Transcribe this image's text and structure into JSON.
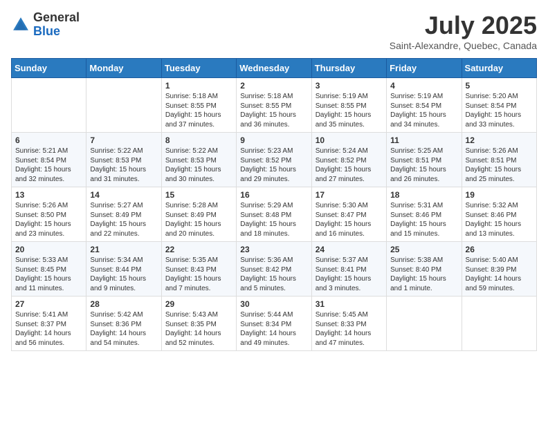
{
  "header": {
    "logo_general": "General",
    "logo_blue": "Blue",
    "month_year": "July 2025",
    "location": "Saint-Alexandre, Quebec, Canada"
  },
  "days_of_week": [
    "Sunday",
    "Monday",
    "Tuesday",
    "Wednesday",
    "Thursday",
    "Friday",
    "Saturday"
  ],
  "weeks": [
    [
      {
        "day": "",
        "sunrise": "",
        "sunset": "",
        "daylight": ""
      },
      {
        "day": "",
        "sunrise": "",
        "sunset": "",
        "daylight": ""
      },
      {
        "day": "1",
        "sunrise": "Sunrise: 5:18 AM",
        "sunset": "Sunset: 8:55 PM",
        "daylight": "Daylight: 15 hours and 37 minutes."
      },
      {
        "day": "2",
        "sunrise": "Sunrise: 5:18 AM",
        "sunset": "Sunset: 8:55 PM",
        "daylight": "Daylight: 15 hours and 36 minutes."
      },
      {
        "day": "3",
        "sunrise": "Sunrise: 5:19 AM",
        "sunset": "Sunset: 8:55 PM",
        "daylight": "Daylight: 15 hours and 35 minutes."
      },
      {
        "day": "4",
        "sunrise": "Sunrise: 5:19 AM",
        "sunset": "Sunset: 8:54 PM",
        "daylight": "Daylight: 15 hours and 34 minutes."
      },
      {
        "day": "5",
        "sunrise": "Sunrise: 5:20 AM",
        "sunset": "Sunset: 8:54 PM",
        "daylight": "Daylight: 15 hours and 33 minutes."
      }
    ],
    [
      {
        "day": "6",
        "sunrise": "Sunrise: 5:21 AM",
        "sunset": "Sunset: 8:54 PM",
        "daylight": "Daylight: 15 hours and 32 minutes."
      },
      {
        "day": "7",
        "sunrise": "Sunrise: 5:22 AM",
        "sunset": "Sunset: 8:53 PM",
        "daylight": "Daylight: 15 hours and 31 minutes."
      },
      {
        "day": "8",
        "sunrise": "Sunrise: 5:22 AM",
        "sunset": "Sunset: 8:53 PM",
        "daylight": "Daylight: 15 hours and 30 minutes."
      },
      {
        "day": "9",
        "sunrise": "Sunrise: 5:23 AM",
        "sunset": "Sunset: 8:52 PM",
        "daylight": "Daylight: 15 hours and 29 minutes."
      },
      {
        "day": "10",
        "sunrise": "Sunrise: 5:24 AM",
        "sunset": "Sunset: 8:52 PM",
        "daylight": "Daylight: 15 hours and 27 minutes."
      },
      {
        "day": "11",
        "sunrise": "Sunrise: 5:25 AM",
        "sunset": "Sunset: 8:51 PM",
        "daylight": "Daylight: 15 hours and 26 minutes."
      },
      {
        "day": "12",
        "sunrise": "Sunrise: 5:26 AM",
        "sunset": "Sunset: 8:51 PM",
        "daylight": "Daylight: 15 hours and 25 minutes."
      }
    ],
    [
      {
        "day": "13",
        "sunrise": "Sunrise: 5:26 AM",
        "sunset": "Sunset: 8:50 PM",
        "daylight": "Daylight: 15 hours and 23 minutes."
      },
      {
        "day": "14",
        "sunrise": "Sunrise: 5:27 AM",
        "sunset": "Sunset: 8:49 PM",
        "daylight": "Daylight: 15 hours and 22 minutes."
      },
      {
        "day": "15",
        "sunrise": "Sunrise: 5:28 AM",
        "sunset": "Sunset: 8:49 PM",
        "daylight": "Daylight: 15 hours and 20 minutes."
      },
      {
        "day": "16",
        "sunrise": "Sunrise: 5:29 AM",
        "sunset": "Sunset: 8:48 PM",
        "daylight": "Daylight: 15 hours and 18 minutes."
      },
      {
        "day": "17",
        "sunrise": "Sunrise: 5:30 AM",
        "sunset": "Sunset: 8:47 PM",
        "daylight": "Daylight: 15 hours and 16 minutes."
      },
      {
        "day": "18",
        "sunrise": "Sunrise: 5:31 AM",
        "sunset": "Sunset: 8:46 PM",
        "daylight": "Daylight: 15 hours and 15 minutes."
      },
      {
        "day": "19",
        "sunrise": "Sunrise: 5:32 AM",
        "sunset": "Sunset: 8:46 PM",
        "daylight": "Daylight: 15 hours and 13 minutes."
      }
    ],
    [
      {
        "day": "20",
        "sunrise": "Sunrise: 5:33 AM",
        "sunset": "Sunset: 8:45 PM",
        "daylight": "Daylight: 15 hours and 11 minutes."
      },
      {
        "day": "21",
        "sunrise": "Sunrise: 5:34 AM",
        "sunset": "Sunset: 8:44 PM",
        "daylight": "Daylight: 15 hours and 9 minutes."
      },
      {
        "day": "22",
        "sunrise": "Sunrise: 5:35 AM",
        "sunset": "Sunset: 8:43 PM",
        "daylight": "Daylight: 15 hours and 7 minutes."
      },
      {
        "day": "23",
        "sunrise": "Sunrise: 5:36 AM",
        "sunset": "Sunset: 8:42 PM",
        "daylight": "Daylight: 15 hours and 5 minutes."
      },
      {
        "day": "24",
        "sunrise": "Sunrise: 5:37 AM",
        "sunset": "Sunset: 8:41 PM",
        "daylight": "Daylight: 15 hours and 3 minutes."
      },
      {
        "day": "25",
        "sunrise": "Sunrise: 5:38 AM",
        "sunset": "Sunset: 8:40 PM",
        "daylight": "Daylight: 15 hours and 1 minute."
      },
      {
        "day": "26",
        "sunrise": "Sunrise: 5:40 AM",
        "sunset": "Sunset: 8:39 PM",
        "daylight": "Daylight: 14 hours and 59 minutes."
      }
    ],
    [
      {
        "day": "27",
        "sunrise": "Sunrise: 5:41 AM",
        "sunset": "Sunset: 8:37 PM",
        "daylight": "Daylight: 14 hours and 56 minutes."
      },
      {
        "day": "28",
        "sunrise": "Sunrise: 5:42 AM",
        "sunset": "Sunset: 8:36 PM",
        "daylight": "Daylight: 14 hours and 54 minutes."
      },
      {
        "day": "29",
        "sunrise": "Sunrise: 5:43 AM",
        "sunset": "Sunset: 8:35 PM",
        "daylight": "Daylight: 14 hours and 52 minutes."
      },
      {
        "day": "30",
        "sunrise": "Sunrise: 5:44 AM",
        "sunset": "Sunset: 8:34 PM",
        "daylight": "Daylight: 14 hours and 49 minutes."
      },
      {
        "day": "31",
        "sunrise": "Sunrise: 5:45 AM",
        "sunset": "Sunset: 8:33 PM",
        "daylight": "Daylight: 14 hours and 47 minutes."
      },
      {
        "day": "",
        "sunrise": "",
        "sunset": "",
        "daylight": ""
      },
      {
        "day": "",
        "sunrise": "",
        "sunset": "",
        "daylight": ""
      }
    ]
  ]
}
